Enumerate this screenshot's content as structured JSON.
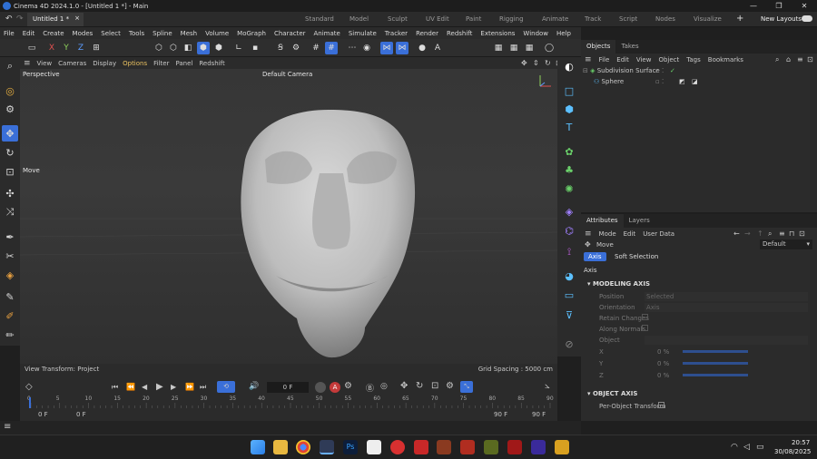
{
  "window": {
    "title": "Cinema 4D 2024.1.0 - [Untitled 1 *] - Main",
    "minimize": "—",
    "maximize": "❐",
    "close": "✕"
  },
  "doc_tab": {
    "label": "Untitled 1 *",
    "close": "×"
  },
  "layouts": [
    "Standard",
    "Model",
    "Sculpt",
    "UV Edit",
    "Paint",
    "Rigging",
    "Animate",
    "Track",
    "Script",
    "Nodes",
    "Visualize"
  ],
  "new_layouts": "New Layouts",
  "menu": [
    "File",
    "Edit",
    "Create",
    "Modes",
    "Select",
    "Tools",
    "Spline",
    "Mesh",
    "Volume",
    "MoGraph",
    "Character",
    "Animate",
    "Simulate",
    "Tracker",
    "Render",
    "Redshift",
    "Extensions",
    "Window",
    "Help"
  ],
  "axes": {
    "x": "X",
    "y": "Y",
    "z": "Z"
  },
  "viewport_menu": [
    "View",
    "Cameras",
    "Display",
    "Options",
    "Filter",
    "Panel",
    "Redshift"
  ],
  "viewport": {
    "label": "Perspective",
    "camera": "Default Camera",
    "tool": "Move",
    "view_transform": "View Transform: Project",
    "grid_spacing": "Grid Spacing : 5000 cm"
  },
  "objects_panel": {
    "tabs": [
      "Objects",
      "Takes"
    ],
    "menu": [
      "File",
      "Edit",
      "View",
      "Object",
      "Tags",
      "Bookmarks"
    ],
    "items": [
      "Subdivision Surface",
      "Sphere"
    ]
  },
  "attributes_panel": {
    "tabs": [
      "Attributes",
      "Layers"
    ],
    "menu": [
      "Mode",
      "Edit",
      "User Data"
    ],
    "tool": "Move",
    "preset": "Default",
    "subtabs": [
      "Axis",
      "Soft Selection"
    ],
    "section": "Axis",
    "group1": "MODELING AXIS",
    "props": {
      "position": "Position",
      "position_val": "Selected",
      "orientation": "Orientation",
      "orientation_val": "Axis",
      "retain": "Retain Changes",
      "normals": "Along Normals",
      "object": "Object",
      "x": "X",
      "x_val": "0 %",
      "y": "Y",
      "y_val": "0 %",
      "z": "Z",
      "z_val": "0 %"
    },
    "group2": "OBJECT AXIS",
    "per_object": "Per-Object Transform"
  },
  "timeline": {
    "frame": "0 F",
    "ruler": [
      "0",
      "5",
      "10",
      "15",
      "20",
      "25",
      "30",
      "35",
      "40",
      "45",
      "50",
      "55",
      "60",
      "65",
      "70",
      "75",
      "80",
      "85",
      "90"
    ],
    "start": "0 F",
    "start2": "0 F",
    "end": "90 F",
    "end2": "90 F"
  },
  "clock": {
    "time": "20:57",
    "date": "30/08/2025"
  },
  "colors": {
    "accent": "#3a6fd8",
    "bg": "#2b2b2b",
    "dark": "#1f1f1f"
  }
}
